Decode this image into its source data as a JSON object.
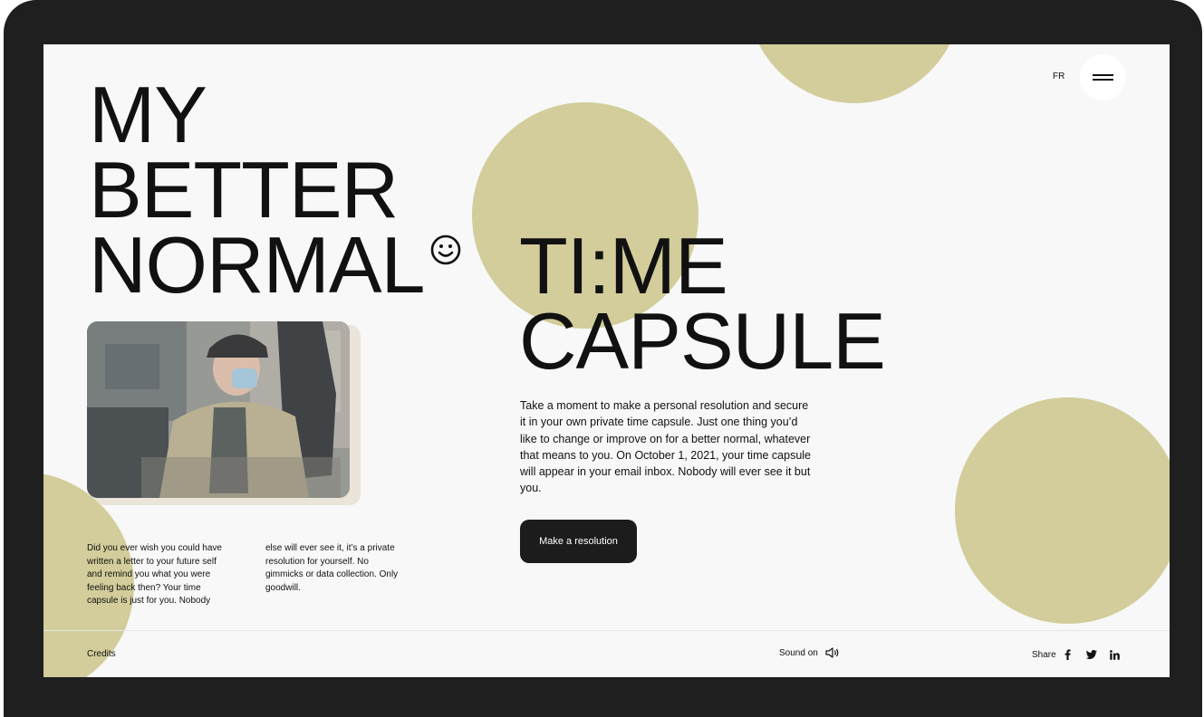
{
  "header": {
    "lang_label": "FR",
    "menu_icon": "hamburger-icon"
  },
  "hero": {
    "title_left": [
      "MY",
      "BETTER",
      "NORMAL"
    ],
    "title_right": [
      "TI:ME",
      "CAPSULE"
    ],
    "title_icon": "smiley-icon"
  },
  "intro_text": "Did you ever wish you could have written a letter to your future self and remind you what you were feeling back then? Your time capsule is just for you. Nobody else will ever see it, it’s a private resolution for yourself. No gimmicks or data collection. Only goodwill.",
  "description": "Take a moment to make a personal resolution and secure it in your own private time capsule. Just one thing you’d like to change or improve on for a better normal, whatever that means to you. On October 1, 2021, your time capsule will appear in your email inbox. Nobody will ever see it but you.",
  "cta_label": "Make a resolution",
  "footer": {
    "credits_label": "Credits",
    "sound_label": "Sound on",
    "sound_icon": "speaker-icon",
    "share_label": "Share",
    "social_icons": [
      "facebook-icon",
      "twitter-icon",
      "linkedin-icon"
    ]
  },
  "colors": {
    "accent_circle": "#d2cd9a",
    "button_bg": "#1c1c1c",
    "screen_bg": "#f8f8f8",
    "bezel": "#1f1f1f"
  }
}
